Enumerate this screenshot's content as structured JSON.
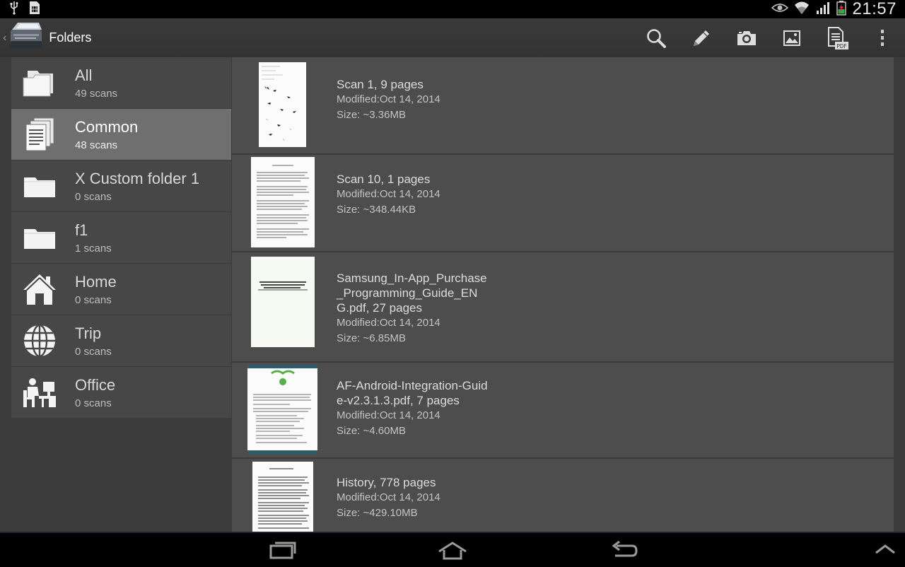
{
  "status_bar": {
    "time": "21:57",
    "icons": [
      "usb-icon",
      "sim-card-icon",
      "eye-icon",
      "wifi-icon",
      "signal-icon",
      "battery-icon"
    ]
  },
  "action_bar": {
    "title": "Folders",
    "actions": [
      "search-icon",
      "pencil-icon",
      "camera-icon",
      "image-icon",
      "pdf-document-icon",
      "overflow-menu-icon"
    ]
  },
  "folders": [
    {
      "name": "All",
      "count": "49 scans",
      "icon": "open-folder-icon",
      "selected": false
    },
    {
      "name": "Common",
      "count": "48 scans",
      "icon": "documents-icon",
      "selected": true
    },
    {
      "name": "X Custom folder 1",
      "count": "0 scans",
      "icon": "folder-icon",
      "selected": false
    },
    {
      "name": "f1",
      "count": "1 scans",
      "icon": "folder-icon",
      "selected": false
    },
    {
      "name": "Home",
      "count": "0 scans",
      "icon": "home-icon",
      "selected": false
    },
    {
      "name": "Trip",
      "count": "0 scans",
      "icon": "globe-icon",
      "selected": false
    },
    {
      "name": "Office",
      "count": "0 scans",
      "icon": "office-worker-icon",
      "selected": false
    }
  ],
  "scans": [
    {
      "title": "Scan 1, 9 pages",
      "modified": "Modified:Oct 14, 2014",
      "size": "Size: ~3.36MB"
    },
    {
      "title": "Scan 10, 1 pages",
      "modified": "Modified:Oct 14, 2014",
      "size": "Size: ~348.44KB"
    },
    {
      "title": "Samsung_In-App_Purchase_Programming_Guide_ENG.pdf, 27 pages",
      "modified": "Modified:Oct 14, 2014",
      "size": "Size: ~6.85MB"
    },
    {
      "title": "AF-Android-Integration-Guide-v2.3.1.3.pdf, 7 pages",
      "modified": "Modified:Oct 14, 2014",
      "size": "Size: ~4.60MB"
    },
    {
      "title": "History, 778 pages",
      "modified": "Modified:Oct 14, 2014",
      "size": "Size: ~429.10MB"
    }
  ],
  "nav_bar": {
    "buttons": [
      "recent-apps-icon",
      "home-nav-icon",
      "back-icon",
      "collapse-chevron-icon"
    ]
  },
  "colors": {
    "background": "#3b3b3b",
    "row": "#4d4d4d",
    "folder_row": "#474747",
    "selected_folder": "#6f6f6f",
    "bars": "#000000"
  }
}
